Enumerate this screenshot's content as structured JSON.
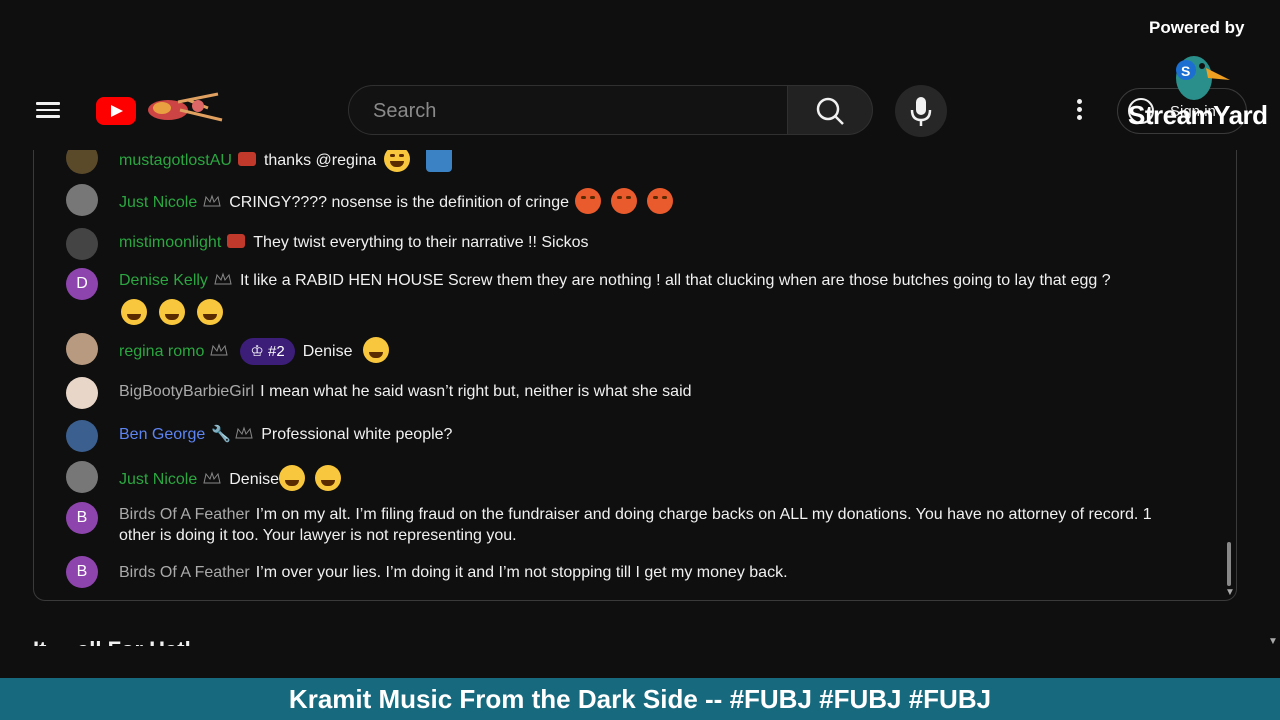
{
  "branding": {
    "powered_by": "Powered by",
    "streamyard": "StreamYard"
  },
  "header": {
    "search_placeholder": "Search",
    "sign_in": "Sign in"
  },
  "chat": [
    {
      "name": "mustagotlostAU",
      "name_color": "green",
      "text": "thanks @regina",
      "emojis": [
        "smile",
        "shirt"
      ],
      "avatar": "photo"
    },
    {
      "name": "Just Nicole",
      "name_color": "green",
      "text": "CRINGY???? nosense is the definition of cringe",
      "emojis": [
        "angry",
        "angry",
        "angry"
      ],
      "avatar": "photo"
    },
    {
      "name": "mistimoonlight",
      "name_color": "green",
      "text": "They twist everything to their narrative !! Sickos",
      "emojis": [],
      "avatar": "photo"
    },
    {
      "name": "Denise Kelly",
      "name_color": "green",
      "text": "It like a RABID HEN HOUSE Screw them they are nothing ! all that clucking when are those butches going to lay that egg ?",
      "emojis": [
        "laugh",
        "laugh",
        "laugh"
      ],
      "avatar": "D"
    },
    {
      "name": "regina romo",
      "name_color": "green",
      "rank": "#2",
      "text": "Denise",
      "emojis": [
        "laugh"
      ],
      "avatar": "photo"
    },
    {
      "name": "BigBootyBarbieGirl",
      "name_color": "gray",
      "text": "I mean what he said wasn’t right but, neither is what she said",
      "emojis": [],
      "avatar": "photo"
    },
    {
      "name": "Ben George",
      "name_color": "blue",
      "text": "Professional white people?",
      "emojis": [],
      "avatar": "photo"
    },
    {
      "name": "Just Nicole",
      "name_color": "green",
      "text": "Denise",
      "emojis": [
        "laugh",
        "laugh"
      ],
      "avatar": "photo"
    },
    {
      "name": "Birds Of A Feather",
      "name_color": "gray",
      "text": "I’m on my alt. I’m filing fraud on the fundraiser and doing charge backs on ALL my donations. You have no attorney of record. 1 other is doing it too. Your lawyer is not representing you.",
      "emojis": [],
      "avatar": "B"
    },
    {
      "name": "Birds Of A Feather",
      "name_color": "gray",
      "text": "I’m over your lies. I’m doing it and I’m not stopping till I get my money back.",
      "emojis": [],
      "avatar": "B"
    }
  ],
  "below_title": "It ... all For Hatl...",
  "ticker": "Kramit Music From the Dark Side -- #FUBJ #FUBJ #FUBJ"
}
